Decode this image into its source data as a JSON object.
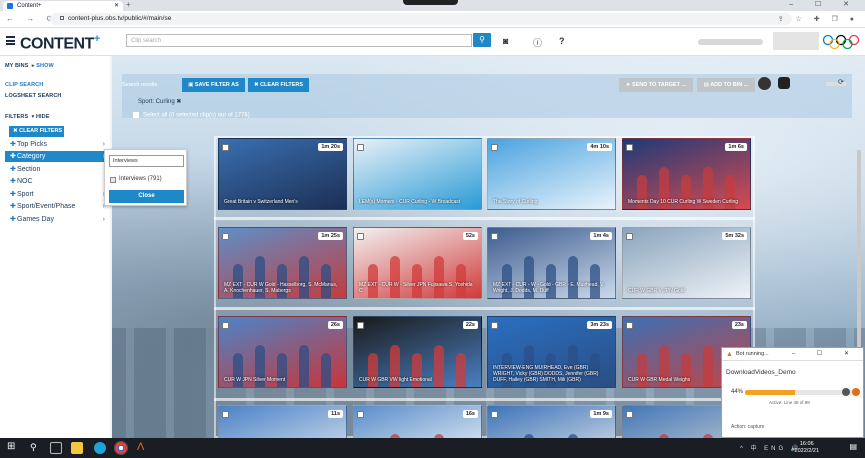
{
  "browser": {
    "tab_title": "Content+",
    "url": "content-plus.obs.tv/public/#/main/se",
    "new_tab": "+",
    "window_controls": "– ☐ ✕"
  },
  "header": {
    "logo": "CONTENT",
    "logo_plus": "+",
    "search_placeholder": "Clip search"
  },
  "sidebar": {
    "my_bins": "MY BINS",
    "my_bins_show": "SHOW",
    "clip_search": "CLIP SEARCH",
    "logsheet_search": "LOGSHEET SEARCH",
    "filters": "FILTERS",
    "filters_hide": "HIDE",
    "clear_filters": "CLEAR FILTERS",
    "items": [
      {
        "label": "Top Picks"
      },
      {
        "label": "Category"
      },
      {
        "label": "Section"
      },
      {
        "label": "NOC"
      },
      {
        "label": "Sport"
      },
      {
        "label": "Sport/Event/Phase"
      },
      {
        "label": "Games Day"
      }
    ]
  },
  "popup": {
    "input_value": "Interviews",
    "option_label": "Interviews (791)",
    "close_label": "Close"
  },
  "results": {
    "title": "Search results",
    "save_filter": "SAVE FILTER AS",
    "clear_filters": "CLEAR FILTERS",
    "send_target": "SEND TO TARGET ...",
    "add_to_bin": "ADD TO BIN ...",
    "sport_chip": "Sport: Curling ✖",
    "select_all": "Select all (0 selected clip(s) out of 1776)"
  },
  "thumbs": [
    {
      "dur": "1m 20s",
      "cap": "Great Britain v Switzerland Men's"
    },
    {
      "dur": "",
      "cap": "LEM(s) Moment - CUR Curling - W Broadcast"
    },
    {
      "dur": "4m 10s",
      "cap": "The Story of Curling"
    },
    {
      "dur": "1m 6s",
      "cap": "Moments Day 10 CUR Curling W Sweden Curling"
    },
    {
      "dur": "1m 25s",
      "cap": "MZ EXT - CUR W Gold - Hasselborg, S. McManus, A. Knochenhauer, S. Mabergs"
    },
    {
      "dur": "52s",
      "cap": "MZ EXT - CUR W - Silver JPN Fujisawa S, Yoshida C"
    },
    {
      "dur": "1m 4s",
      "cap": "MZ EXT - CUR - W - Gold - GBR - E. Muirhead, V. Wright, J. Dodds, M. Duff"
    },
    {
      "dur": "5m 32s",
      "cap": "CUR W GBR V JPN Gold"
    },
    {
      "dur": "26s",
      "cap": "CUR W JPN Silver Moment"
    },
    {
      "dur": "22s",
      "cap": "CUR W GBR VW light Emotional"
    },
    {
      "dur": "3m 23s",
      "cap": "INTERVIEW-ENG MUIRHEAD, Eve (GBR) WRIGHT, Vicky (GBR) DODDS, Jennifer (GBR) DUFF, Hailey (GBR) SMITH, Mili (GBR)"
    },
    {
      "dur": "23s",
      "cap": "CUR W GBR Medal Weighs"
    },
    {
      "dur": "11s",
      "cap": ""
    },
    {
      "dur": "16s",
      "cap": ""
    },
    {
      "dur": "1m 9s",
      "cap": ""
    },
    {
      "dur": "1m 4s",
      "cap": ""
    }
  ],
  "bot": {
    "title": "Bot running...",
    "name": "DownloadVideos_Demo",
    "percent": "44%",
    "progress": 44,
    "active_line": "Active: Line 48 of 88",
    "action": "Action: capture"
  },
  "taskbar": {
    "time": "16:06",
    "date": "2022/2/21",
    "tray": "^ 中 ENG 🔊"
  },
  "colors": {
    "accent": "#1e88c8",
    "navy": "#1e3b5a",
    "progress": "#f4a020"
  }
}
